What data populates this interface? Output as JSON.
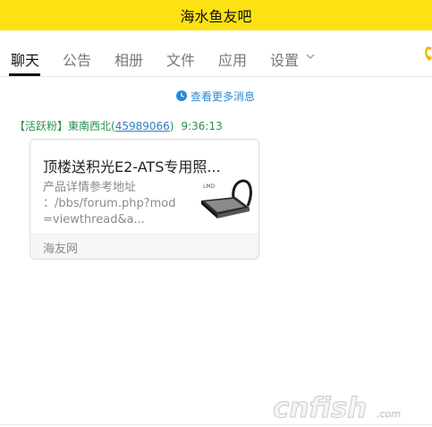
{
  "window": {
    "title": "海水鱼友吧"
  },
  "tabs": [
    {
      "label": "聊天",
      "active": true
    },
    {
      "label": "公告"
    },
    {
      "label": "相册"
    },
    {
      "label": "文件"
    },
    {
      "label": "应用"
    },
    {
      "label": "设置"
    }
  ],
  "chat": {
    "load_more_label": "查看更多消息",
    "message": {
      "badge": "【活跃粉】",
      "sender_name": "東南西北",
      "uid_open": "(",
      "uid": "45989066",
      "uid_close": ")",
      "time": "9:36:13",
      "card": {
        "title": "顶楼送积光E2-ATS专用照...",
        "desc_lines": [
          "产品详情参考地址",
          "：/bbs/forum.php?mod",
          "=viewthread&a..."
        ],
        "source": "海友网",
        "thumb_label": "LMD"
      }
    }
  },
  "watermark": {
    "text": "cnfish",
    "suffix": ".com"
  },
  "colors": {
    "title_bar": "#fde213",
    "accent_blue": "#2a8ad8",
    "sender_green": "#2a8f4f"
  },
  "icons": [
    "clock-icon",
    "chevron-down-icon",
    "phone-icon"
  ]
}
